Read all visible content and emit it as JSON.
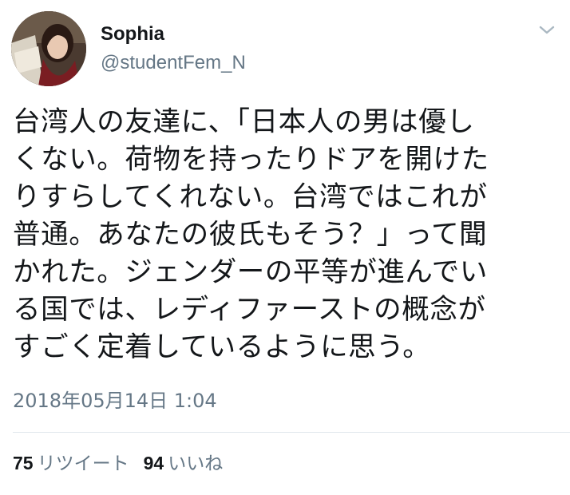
{
  "tweet": {
    "author": {
      "display_name": "Sophia",
      "handle": "@studentFem_N",
      "avatar_icon": "profile-photo"
    },
    "menu_icon": "chevron-down-icon",
    "text_lines": [
      "台湾人の友達に、「日本人の男は優し",
      "くない。荷物を持ったりドアを開けた",
      "りすらしてくれない。台湾ではこれが",
      "普通。あなたの彼氏もそう？」って聞",
      "かれた。ジェンダーの平等が進んでい",
      "る国では、レディファーストの概念が",
      "すごく定着しているように思う。"
    ],
    "timestamp": "2018年05月14日 1:04",
    "stats": {
      "retweets_count": "75",
      "retweets_label": "リツイート",
      "likes_count": "94",
      "likes_label": "いいね"
    },
    "colors": {
      "text": "#14171a",
      "secondary": "#657786",
      "divider": "#e1e8ed"
    }
  }
}
